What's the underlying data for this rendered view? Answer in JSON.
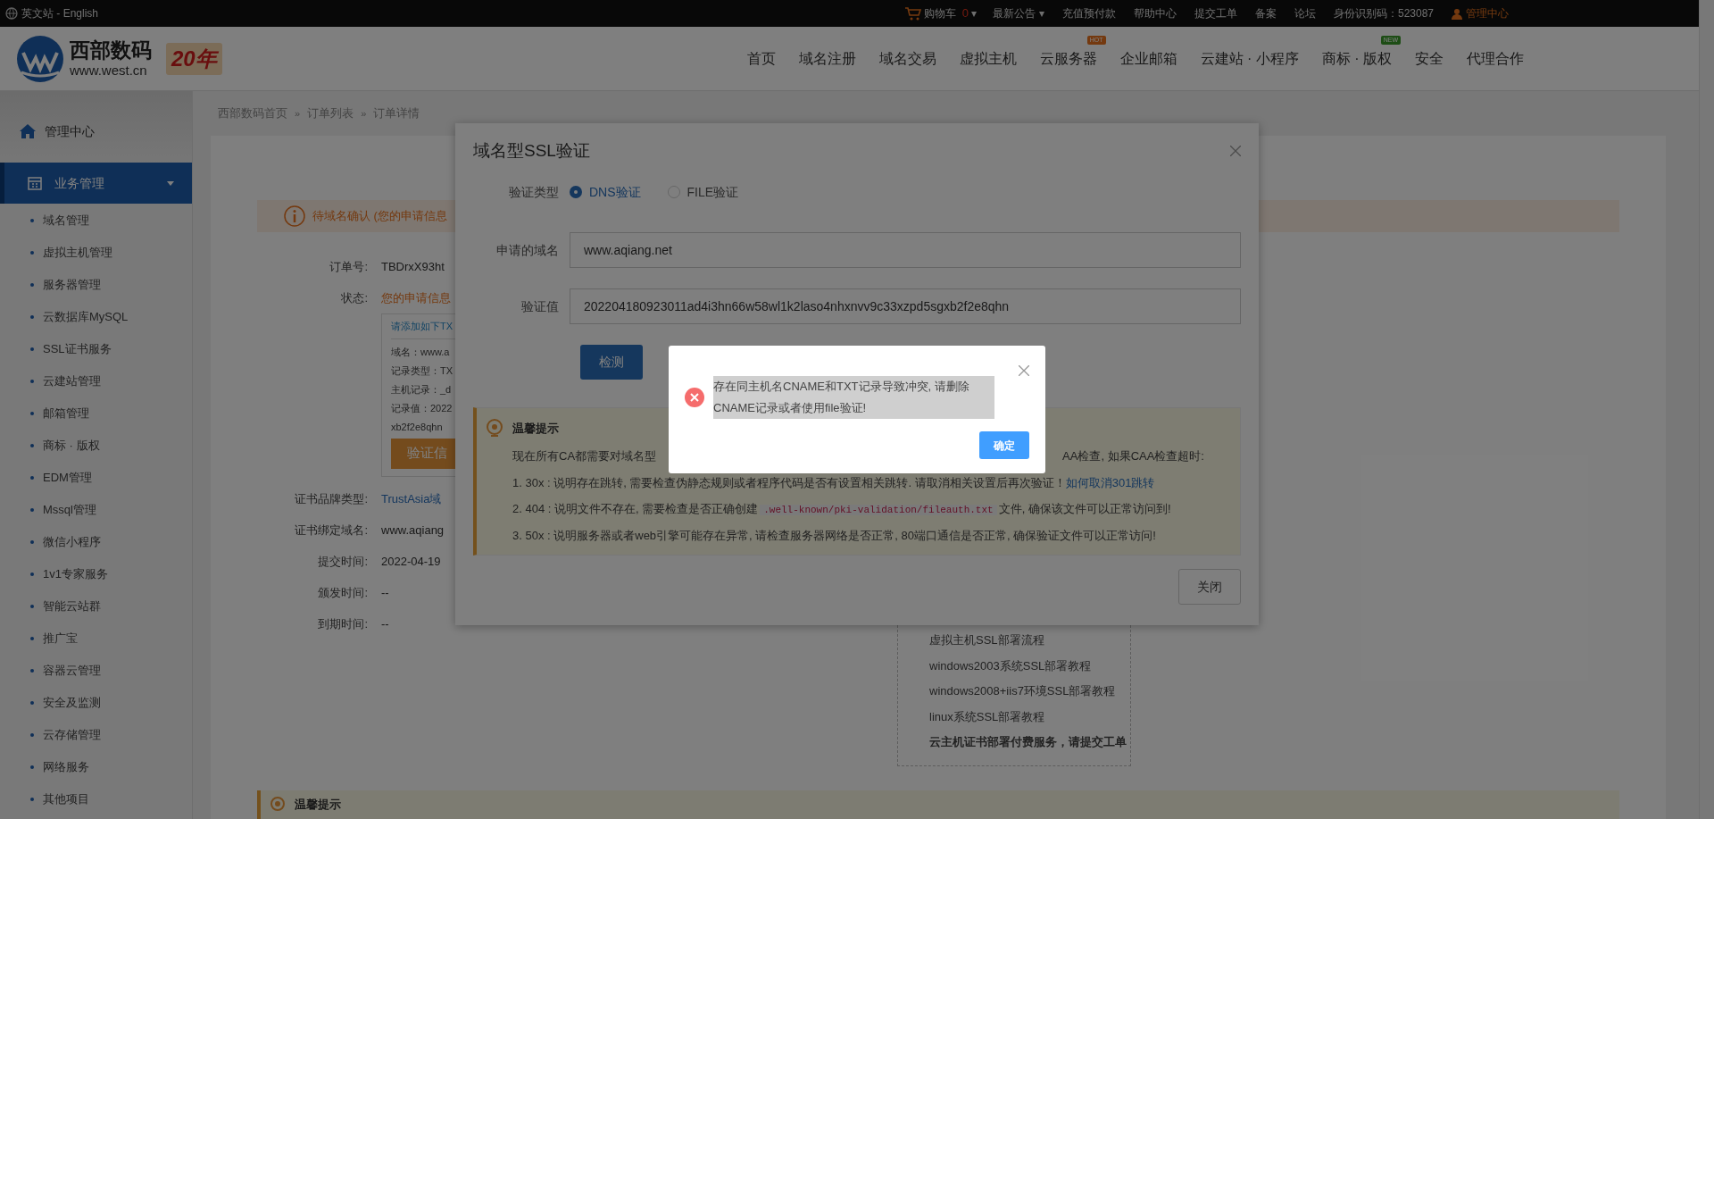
{
  "topbar": {
    "site_switch": "英文站 - English",
    "cart": {
      "label": "购物车",
      "count": "0",
      "caret": "▾"
    },
    "links": [
      {
        "label": "最新公告",
        "caret": "▾"
      },
      {
        "label": "充值预付款"
      },
      {
        "label": "帮助中心"
      },
      {
        "label": "提交工单"
      },
      {
        "label": "备案"
      },
      {
        "label": "论坛"
      },
      {
        "label": "身份识别码：523087"
      }
    ],
    "account": "管理中心"
  },
  "header": {
    "logo_name": "西部数码",
    "logo_url": "www.west.cn",
    "anniversary": "20年",
    "nav": [
      {
        "kind": "plain",
        "label": "首页"
      },
      {
        "kind": "plain",
        "label": "域名注册"
      },
      {
        "kind": "plain",
        "label": "域名交易"
      },
      {
        "kind": "plain",
        "label": "虚拟主机"
      },
      {
        "kind": "hot",
        "label": "云服务器",
        "badge": "HOT"
      },
      {
        "kind": "plain",
        "label": "企业邮箱"
      },
      {
        "kind": "plain",
        "label": "云建站 · 小程序"
      },
      {
        "kind": "new",
        "label": "商标 · 版权",
        "badge": "NEW"
      },
      {
        "kind": "plain",
        "label": "安全"
      },
      {
        "kind": "plain",
        "label": "代理合作"
      }
    ]
  },
  "sidebar": {
    "home": "管理中心",
    "group": {
      "label": "业务管理",
      "selected": true,
      "expanded": true,
      "items": [
        "域名管理",
        "虚拟主机管理",
        "服务器管理",
        "云数据库MySQL",
        "SSL证书服务",
        "云建站管理",
        "邮箱管理",
        "商标 · 版权",
        "EDM管理",
        "Mssql管理",
        "微信小程序",
        "1v1专家服务",
        "智能云站群",
        "推广宝",
        "容器云管理",
        "安全及监测",
        "云存储管理",
        "网络服务",
        "其他项目"
      ]
    }
  },
  "breadcrumb": [
    "西部数码首页",
    "订单列表",
    "订单详情"
  ],
  "breadcrumb_separator": "»",
  "notice": "待域名确认 (您的申请信息",
  "details": [
    {
      "kind": "field",
      "label": "订单号:",
      "value": "TBDrxX93ht"
    },
    {
      "kind": "status",
      "label": "状态:",
      "value": "您的申请信息"
    },
    {
      "kind": "dns_box",
      "title": "请添加如下TX",
      "lines": [
        "域名：www.a",
        "记录类型：TX",
        "主机记录：_d",
        "记录值：2022",
        "xb2f2e8qhn"
      ],
      "button": "验证信"
    },
    {
      "kind": "link",
      "label": "证书品牌类型:",
      "value": "TrustAsia域"
    },
    {
      "kind": "field",
      "label": "证书绑定域名:",
      "value": "www.aqiang"
    },
    {
      "kind": "field",
      "label": "提交时间:",
      "value": "2022-04-19"
    },
    {
      "kind": "field",
      "label": "颁发时间:",
      "value": "--"
    },
    {
      "kind": "field",
      "label": "到期时间:",
      "value": "--"
    }
  ],
  "guides": [
    {
      "label": "虚拟主机SSL部署流程",
      "bold": false
    },
    {
      "label": "windows2003系统SSL部署教程",
      "bold": false
    },
    {
      "label": "windows2008+iis7环境SSL部署教程",
      "bold": false
    },
    {
      "label": "linux系统SSL部署教程",
      "bold": false
    },
    {
      "label": "云主机证书部署付费服务，请提交工单",
      "bold": true
    }
  ],
  "bottom_tip": "温馨提示",
  "ssl_dialog": {
    "title": "域名型SSL验证",
    "type_label": "验证类型",
    "types": [
      {
        "label": "DNS验证",
        "selected": true
      },
      {
        "label": "FILE验证",
        "selected": false
      }
    ],
    "domain_label": "申请的域名",
    "domain_value": "www.aqiang.net",
    "value_label": "验证值",
    "verify_value": "202204180923011ad4i3hn66w58wl1k2laso4nhxnvv9c33xzpd5sgxb2f2e8qhn",
    "check_button": "检测",
    "tips": {
      "title": "温馨提示",
      "intro_start": "现在所有CA都需要对域名型",
      "intro_end": "AA检查, 如果CAA检查超时:",
      "items": [
        {
          "text": "1. 30x : 说明存在跳转, 需要检查伪静态规则或者程序代码是否有设置相关跳转. 请取消相关设置后再次验证！",
          "link": "如何取消301跳转"
        },
        {
          "text": "2. 404 : 说明文件不存在, 需要检查是否正确创建",
          "code": ".well-known/pki-validation/fileauth.txt",
          "after": "文件, 确保该文件可以正常访问到!"
        },
        {
          "text": "3. 50x : 说明服务器或者web引擎可能存在异常, 请检查服务器网络是否正常, 80端口通信是否正常, 确保验证文件可以正常访问!"
        }
      ]
    },
    "close_button": "关闭"
  },
  "alert": {
    "message": "存在同主机名CNAME和TXT记录导致冲突, 请删除CNAME记录或者使用file验证!",
    "ok_button": "确定"
  }
}
